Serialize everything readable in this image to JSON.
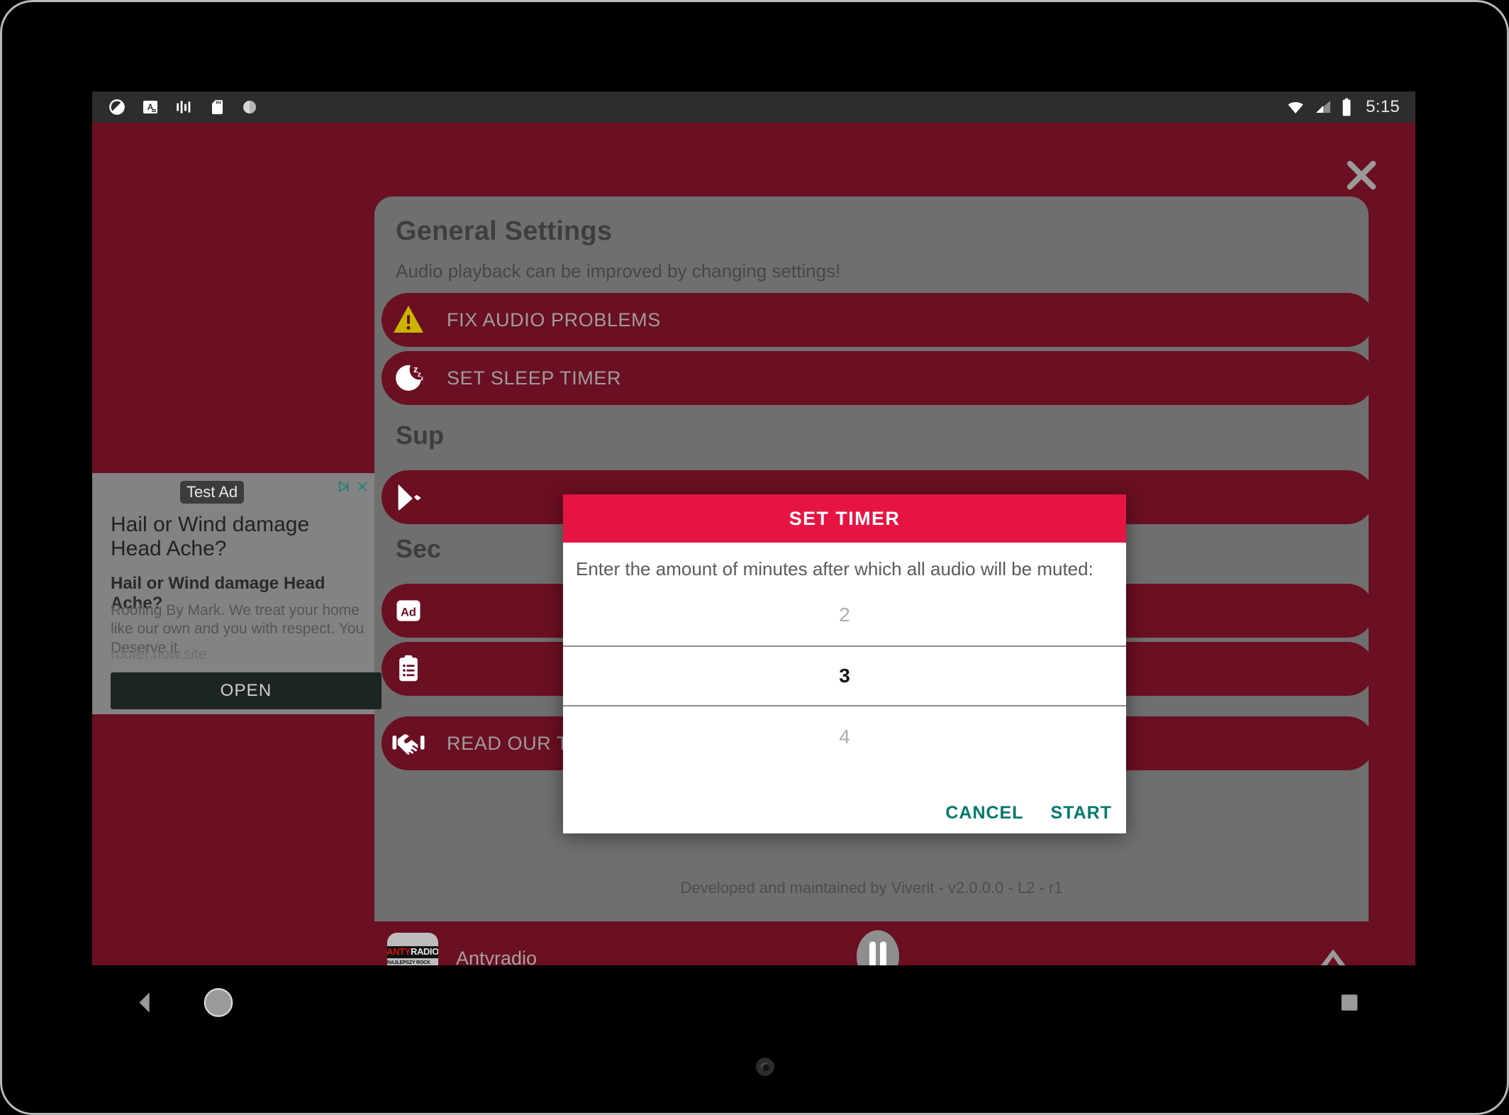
{
  "status_bar": {
    "icons": [
      "do-not-disturb-icon",
      "font-size-a-icon",
      "equalizer-icon",
      "sd-card-icon",
      "sync-icon"
    ],
    "wifi_icon": "wifi-icon",
    "signal_icon": "cell-signal-icon",
    "battery_icon": "battery-icon",
    "time": "5:15"
  },
  "app": {
    "close_label": "close-icon",
    "page_title": "General Settings",
    "page_subtitle": "Audio playback can be improved by changing settings!",
    "footer": "Developed and maintained by Viverit - v2.0.0.0 - L2 - r1",
    "accent_red": "#6b0f22",
    "dialog_accent": "#e61443"
  },
  "settings": {
    "general_rows": [
      {
        "icon": "warning-triangle-icon",
        "label": "FIX AUDIO PROBLEMS"
      },
      {
        "icon": "sleep-moon-icon",
        "label": "SET SLEEP TIMER"
      }
    ],
    "support_heading": "Sup",
    "support_rows": [
      {
        "icon": "google-play-icon",
        "label": ""
      }
    ],
    "security_heading": "Sec",
    "security_rows": [
      {
        "icon": "ad-icon",
        "label": ""
      },
      {
        "icon": "clipboard-list-icon",
        "label": ""
      }
    ],
    "terms_row": {
      "icon": "handshake-icon",
      "label": "READ OUR TERMS AND SERVICES"
    }
  },
  "ad": {
    "badge": "Test Ad",
    "adchoices_icon": "adchoices-icon",
    "close_icon": "close-icon",
    "title": "Hail or Wind damage Head Ache?",
    "subtitle": "Hail or Wind damage Head Ache?",
    "body": "Roofing By Mark. We treat your home like our own and you with respect. You Deserve it.",
    "url": "roofer.now.site",
    "cta": "OPEN"
  },
  "player": {
    "station_logo_top": "ANTYRADIO",
    "station_logo_sub": "NAJLEPSZY ROCK NA SWIECIE",
    "station_name": "Antyradio",
    "play_pause_icon": "pause-icon",
    "expand_icon": "chevron-up-icon"
  },
  "dialog": {
    "title": "SET TIMER",
    "prompt": "Enter the amount of minutes after which all audio will be muted:",
    "picker_values": [
      "2",
      "3",
      "4"
    ],
    "picker_selected_index": 1,
    "cancel_label": "CANCEL",
    "start_label": "START"
  },
  "navigation": {
    "back_icon": "back-triangle-icon",
    "home_icon": "home-circle-icon",
    "recents_icon": "recents-square-icon"
  }
}
